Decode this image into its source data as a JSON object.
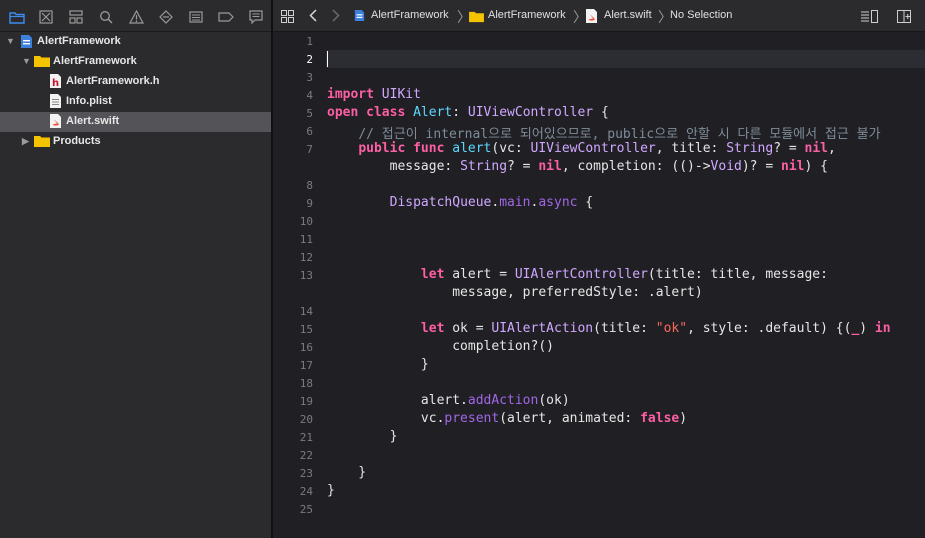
{
  "navigator": {
    "icons": [
      "folder-icon",
      "source-control-icon",
      "symbol-icon",
      "find-icon",
      "issue-icon",
      "test-icon",
      "debug-icon",
      "breakpoint-icon",
      "report-icon"
    ],
    "items": [
      {
        "label": "AlertFramework",
        "icon": "project-icon",
        "level": 0,
        "expanded": true,
        "selected": false
      },
      {
        "label": "AlertFramework",
        "icon": "folder-icon",
        "level": 1,
        "expanded": true,
        "selected": false
      },
      {
        "label": "AlertFramework.h",
        "icon": "header-file-icon",
        "level": 2,
        "selected": false
      },
      {
        "label": "Info.plist",
        "icon": "plist-file-icon",
        "level": 2,
        "selected": false
      },
      {
        "label": "Alert.swift",
        "icon": "swift-file-icon",
        "level": 2,
        "selected": true
      },
      {
        "label": "Products",
        "icon": "folder-icon",
        "level": 1,
        "expanded": false,
        "selected": false
      }
    ]
  },
  "jumpbar": {
    "crumbs": [
      "AlertFramework",
      "AlertFramework",
      "Alert.swift",
      "No Selection"
    ]
  },
  "editor": {
    "current_line": 2,
    "lines": [
      "",
      "",
      "",
      "import UIKit",
      "open class Alert: UIViewController {",
      "    // 접근이 internal으로 되어있으므로, public으로 안할 시 다른 모듈에서 접근 불가",
      "    public func alert(vc: UIViewController, title: String? = nil,",
      "        message: String? = nil, completion: (()->Void)? = nil) {",
      "",
      "        DispatchQueue.main.async {",
      "",
      "",
      "            let alert = UIAlertController(title: title, message:",
      "                message, preferredStyle: .alert)",
      "",
      "            let ok = UIAlertAction(title: \"ok\", style: .default) {(_) in",
      "                completion?()",
      "            }",
      "",
      "            alert.addAction(ok)",
      "            vc.present(alert, animated: false)",
      "        }",
      "",
      "    }",
      "}",
      ""
    ],
    "line_numbers": [
      "1",
      "2",
      "3",
      "4",
      "5",
      "6",
      "7",
      "",
      "8",
      "9",
      "10",
      "11",
      "12",
      "13",
      "",
      "14",
      "15",
      "16",
      "17",
      "18",
      "19",
      "20",
      "21",
      "22",
      "23",
      "24",
      "25"
    ]
  },
  "colors": {
    "keyword": "#fc5fa3",
    "type": "#d0a8ff",
    "declared_type": "#5dd8ff",
    "function": "#67b7a4",
    "string": "#fc6a5d",
    "comment": "#7f8c98",
    "member": "#a167e6",
    "selection": "#545458"
  }
}
